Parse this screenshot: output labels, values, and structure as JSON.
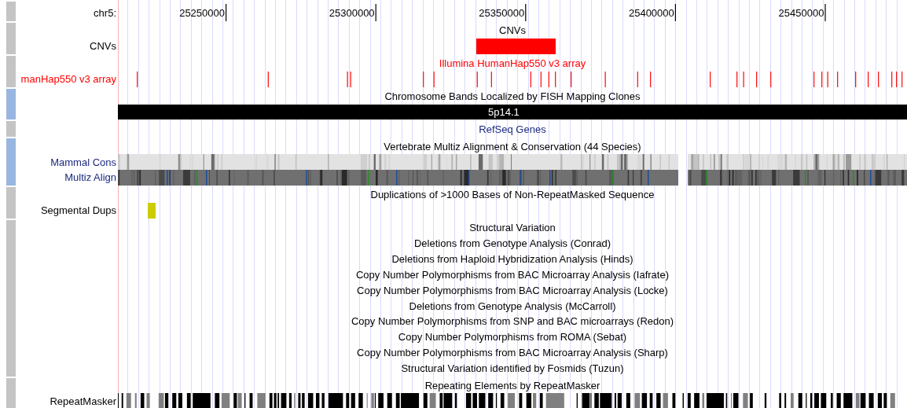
{
  "groups": [
    {
      "kind": "ruler",
      "color": "#c4c4c4",
      "label": "chr5:",
      "ticks": [
        "25250000",
        "25300000",
        "25350000",
        "25400000",
        "25450000"
      ]
    },
    {
      "kind": "track",
      "color": "#c4c4c4",
      "title": {
        "text": "CNVs",
        "color": "#000000"
      },
      "rows": [
        {
          "kind": "cnv",
          "label": "CNVs",
          "color": "#000000"
        }
      ]
    },
    {
      "kind": "track",
      "color": "#c4c4c4",
      "title": {
        "text": "Illumina HumanHap550 v3 array",
        "color": "#ff0000"
      },
      "rows": [
        {
          "kind": "snps",
          "label": "manHap550 v3 array",
          "color": "#ff0000"
        }
      ]
    },
    {
      "kind": "track",
      "color": "#98b6e0",
      "title": {
        "text": "Chromosome Bands Localized by FISH Mapping Clones",
        "color": "#000000"
      },
      "rows": [
        {
          "kind": "band",
          "text": "5p14.1"
        }
      ]
    },
    {
      "kind": "track",
      "color": "#c4c4c4",
      "title": {
        "text": "RefSeq Genes",
        "color": "#1c2a80"
      }
    },
    {
      "kind": "track",
      "color": "#98b6e0",
      "title": {
        "text": "Vertebrate Multiz Alignment & Conservation (44 Species)",
        "color": "#000000"
      },
      "rows": [
        {
          "kind": "conservation",
          "label": "Mammal Cons",
          "color": "#1c2a80"
        },
        {
          "kind": "alignment",
          "label": "Multiz Align",
          "color": "#1c2a80"
        }
      ]
    },
    {
      "kind": "track",
      "color": "#c4c4c4",
      "title": {
        "text": "Duplications of >1000 Bases of Non-RepeatMasked Sequence",
        "color": "#000000"
      },
      "rows": [
        {
          "kind": "dups",
          "label": "Segmental Dups",
          "color": "#000000"
        }
      ]
    },
    {
      "kind": "track",
      "color": "#c4c4c4",
      "title": {
        "text": "Structural Variation",
        "color": "#000000"
      },
      "rows": [
        {
          "kind": "subtitle",
          "text": "Deletions from Genotype Analysis (Conrad)"
        },
        {
          "kind": "subtitle",
          "text": "Deletions from Haploid Hybridization Analysis (Hinds)"
        },
        {
          "kind": "subtitle",
          "text": "Copy Number Polymorphisms from BAC Microarray Analysis (Iafrate)"
        },
        {
          "kind": "subtitle",
          "text": "Copy Number Polymorphisms from BAC Microarray Analysis (Locke)"
        },
        {
          "kind": "subtitle",
          "text": "Deletions from Genotype Analysis (McCarroll)"
        },
        {
          "kind": "subtitle",
          "text": "Copy Number Polymorphisms from SNP and BAC microarrays (Redon)"
        },
        {
          "kind": "subtitle",
          "text": "Copy Number Polymorphisms from ROMA (Sebat)"
        },
        {
          "kind": "subtitle",
          "text": "Copy Number Polymorphisms from BAC Microarray Analysis (Sharp)"
        },
        {
          "kind": "subtitle",
          "text": "Structural Variation identified by Fosmids (Tuzun)"
        }
      ]
    },
    {
      "kind": "track",
      "color": "#c4c4c4",
      "title": {
        "text": "Repeating Elements by RepeatMasker",
        "color": "#000000"
      },
      "rows": [
        {
          "kind": "repeats",
          "label": "RepeatMasker",
          "color": "#000000"
        }
      ]
    }
  ]
}
